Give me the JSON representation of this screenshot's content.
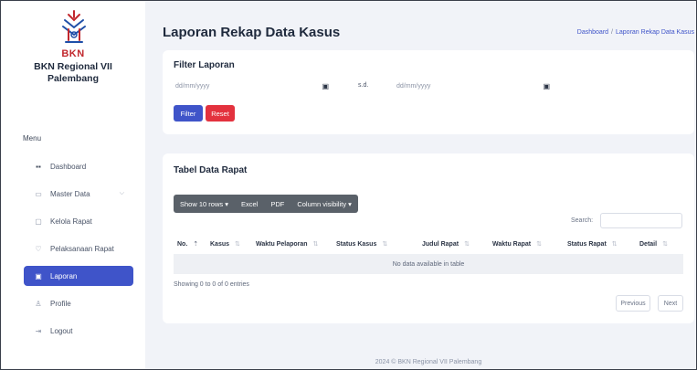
{
  "sidebar": {
    "brand": "BKN",
    "subtitle_line1": "BKN Regional VII",
    "subtitle_line2": "Palembang",
    "menu_title": "Menu",
    "items": [
      {
        "label": "Dashboard",
        "icon": "grid-icon",
        "active": false
      },
      {
        "label": "Master Data",
        "icon": "database-icon",
        "active": false,
        "has_submenu": true
      },
      {
        "label": "Kelola Rapat",
        "icon": "monitor-icon",
        "active": false
      },
      {
        "label": "Pelaksanaan Rapat",
        "icon": "cup-icon",
        "active": false
      },
      {
        "label": "Laporan",
        "icon": "report-icon",
        "active": true
      },
      {
        "label": "Profile",
        "icon": "user-icon",
        "active": false
      },
      {
        "label": "Logout",
        "icon": "logout-icon",
        "active": false
      }
    ]
  },
  "header": {
    "title": "Laporan Rekap Data Kasus",
    "breadcrumb": [
      "Dashboard",
      "Laporan Rekap Data Kasus"
    ]
  },
  "filter": {
    "title": "Filter Laporan",
    "start_placeholder": "dd/mm/yyyy",
    "separator": "s.d.",
    "end_placeholder": "dd/mm/yyyy",
    "filter_button": "Filter",
    "reset_button": "Reset"
  },
  "table": {
    "title": "Tabel Data Rapat",
    "toolbar": {
      "show_rows": "Show 10 rows",
      "excel": "Excel",
      "pdf": "PDF",
      "column_visibility": "Column visibility"
    },
    "search_label": "Search:",
    "columns": [
      "No.",
      "Kasus",
      "Waktu Pelaporan",
      "Status Kasus",
      "Judul Rapat",
      "Waktu Rapat",
      "Status Rapat",
      "Detail"
    ],
    "empty_message": "No data available in table",
    "info": "Showing 0 to 0 of 0 entries",
    "previous": "Previous",
    "next": "Next"
  },
  "footer": "2024 © BKN Regional VII Palembang",
  "colors": {
    "accent": "#3f54c9",
    "danger": "#e3323e",
    "brand_red": "#c1272d"
  }
}
